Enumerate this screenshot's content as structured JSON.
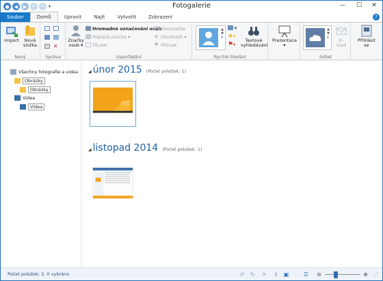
{
  "window": {
    "title": "Fotogalerie"
  },
  "tabs": [
    {
      "label": "Soubor"
    },
    {
      "label": "Domů"
    },
    {
      "label": "Upravit"
    },
    {
      "label": "Najít"
    },
    {
      "label": "Vytvořit"
    },
    {
      "label": "Zobrazení"
    }
  ],
  "ribbon": {
    "new_group": {
      "label": "Nový",
      "import": "Import",
      "new_folder_1": "Nová",
      "new_folder_2": "složka"
    },
    "manage_group": {
      "label": "Správa"
    },
    "organize_group": {
      "label": "Uspořádání",
      "tags_1": "Značky",
      "tags_2": "osob",
      "bulk_tag": "Hromadné označování osob",
      "desc_tag": "Popisná značka",
      "caption": "Titulek",
      "geotag": "Geoznačka",
      "rate": "Ohodnotit",
      "flag": "Příznak"
    },
    "quickfind_group": {
      "label": "Rychlé hledání",
      "text_search_1": "Textové",
      "text_search_2": "vyhledávání"
    },
    "slideshow": {
      "label": "Prezentace"
    },
    "share_group": {
      "label": "Sdílet",
      "email_1": "E-",
      "email_2": "mail"
    },
    "signin": {
      "label_1": "Přihlásit",
      "label_2": "se"
    }
  },
  "nav": {
    "all": "Všechny fotografie a videa",
    "pictures": "Obrázky",
    "pictures_sub": "Obrázky",
    "videos": "Videa",
    "videos_sub": "Videa"
  },
  "main": {
    "groups": [
      {
        "title": "únor 2015",
        "count": "(Počet položek: 1)"
      },
      {
        "title": "listopad 2014",
        "count": "(Počet položek: 1)"
      }
    ]
  },
  "status": {
    "text": "Počet položek: 2, 0 vybráno"
  },
  "colors": {
    "accent": "#1979ca",
    "heading": "#1e5fa8",
    "thumb1": "#f2a31a",
    "folder": "#f5c242"
  }
}
